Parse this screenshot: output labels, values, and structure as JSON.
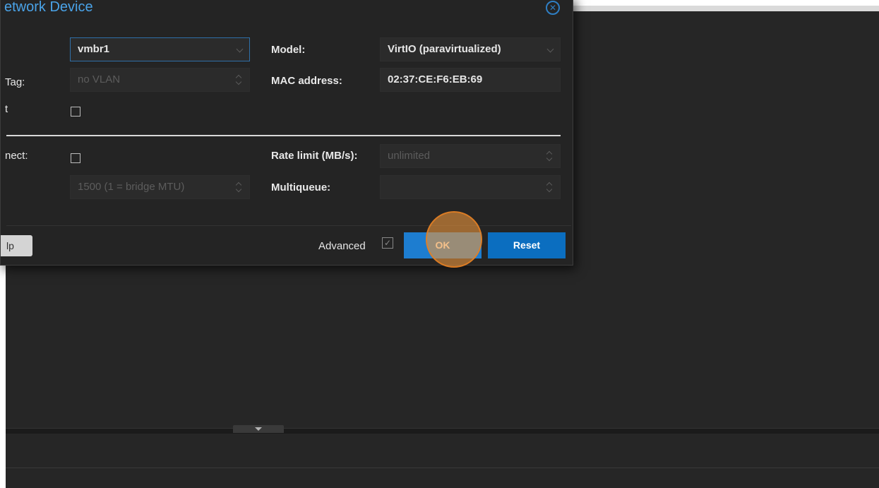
{
  "dialog": {
    "title": "etwork Device",
    "close_icon": "close-icon",
    "labels": {
      "bridge_cut": "",
      "vlan_tag": "Tag:",
      "firewall": "t",
      "disconnect": "nect:",
      "model": "Model:",
      "mac": "MAC address:",
      "rate_limit": "Rate limit (MB/s):",
      "multiqueue": "Multiqueue:"
    },
    "fields": {
      "bridge": "vmbr1",
      "vlan_tag_placeholder": "no VLAN",
      "mtu_placeholder": "1500 (1 = bridge MTU)",
      "model": "VirtIO (paravirtualized)",
      "mac": "02:37:CE:F6:EB:69",
      "rate_limit_placeholder": "unlimited",
      "multiqueue": ""
    },
    "footer": {
      "help_label": "lp",
      "advanced_label": "Advanced",
      "advanced_checked": true,
      "ok_label": "OK",
      "reset_label": "Reset"
    }
  },
  "colors": {
    "background": "#262626",
    "dialog": "#242424",
    "title": "#4aa3e8",
    "primary_button": "#0b6ec0",
    "highlight": "#ec963c"
  }
}
